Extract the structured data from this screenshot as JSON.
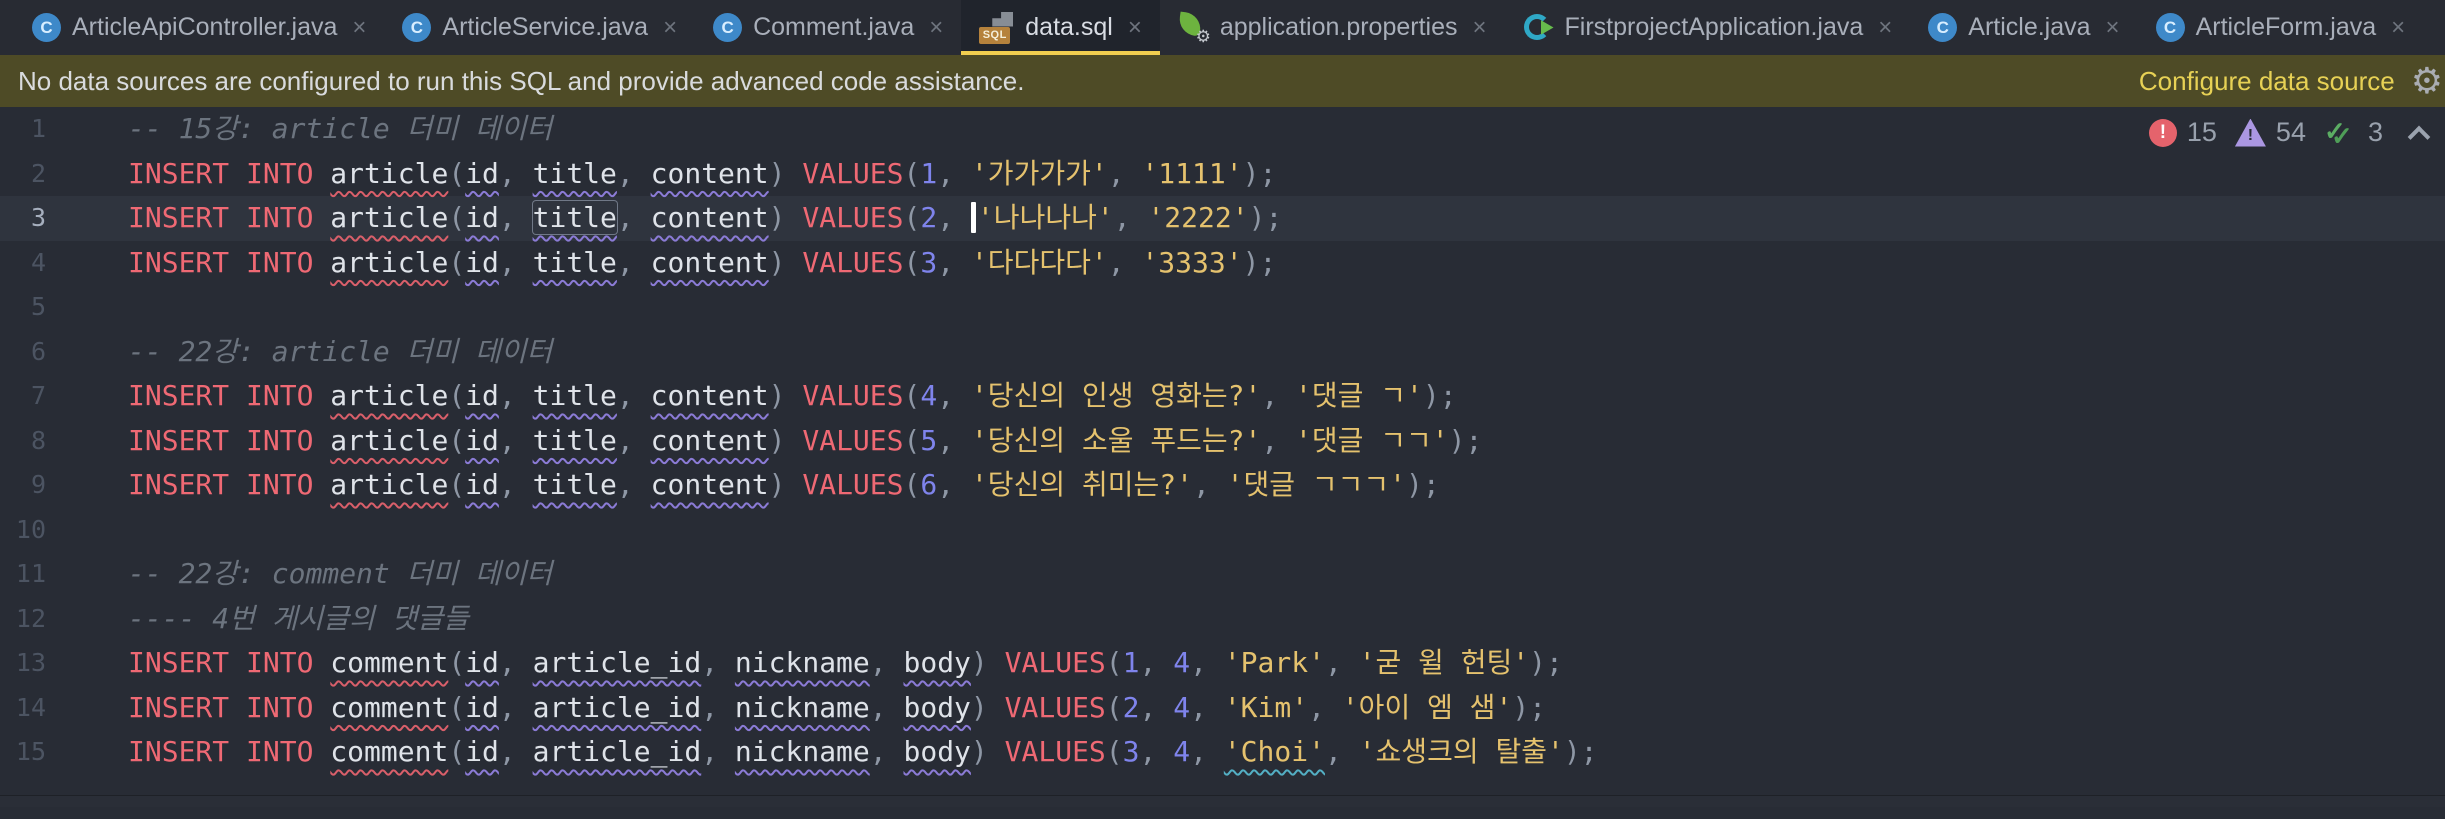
{
  "tabs": [
    {
      "label": "ArticleApiController.java",
      "icon": "java-class-icon",
      "active": false
    },
    {
      "label": "ArticleService.java",
      "icon": "java-class-icon",
      "active": false
    },
    {
      "label": "Comment.java",
      "icon": "java-class-icon",
      "active": false
    },
    {
      "label": "data.sql",
      "icon": "sql-file-icon",
      "active": true
    },
    {
      "label": "application.properties",
      "icon": "spring-properties-icon",
      "active": false
    },
    {
      "label": "FirstprojectApplication.java",
      "icon": "spring-boot-icon",
      "active": false
    },
    {
      "label": "Article.java",
      "icon": "java-class-icon",
      "active": false
    },
    {
      "label": "ArticleForm.java",
      "icon": "java-class-icon",
      "active": false
    }
  ],
  "banner": {
    "message": "No data sources are configured to run this SQL and provide advanced code assistance.",
    "action_label": "Configure data source"
  },
  "inspections": {
    "errors": "15",
    "warnings": "54",
    "ok": "3"
  },
  "icons": {
    "close_glyph": "×",
    "gear_glyph": "⚙",
    "java_class_letter": "C",
    "sql_label": "SQL",
    "exclamation": "!",
    "check": "✓"
  },
  "colors": {
    "editor_background": "#282C35",
    "caret_row": "#2F343E",
    "banner_background": "#4E4B26",
    "active_tab_underline": "#F2CF4F",
    "keyword": "#EF6974",
    "string": "#E5C26E",
    "number": "#7F84EC",
    "comment": "#6C747F",
    "error": "#E5636C",
    "warning": "#AB97E2",
    "success": "#5BAD63"
  },
  "editor": {
    "active_line": 3,
    "lines": [
      {
        "num": "1",
        "segments": [
          {
            "t": "-- 15강: article 더미 데이터",
            "c": "cm"
          }
        ]
      },
      {
        "num": "2",
        "segments": [
          {
            "t": "INSERT INTO",
            "c": "k"
          },
          {
            "t": " ",
            "c": "p"
          },
          {
            "t": "article",
            "c": "tbl"
          },
          {
            "t": "(",
            "c": "p"
          },
          {
            "t": "id",
            "c": "col"
          },
          {
            "t": ", ",
            "c": "p"
          },
          {
            "t": "title",
            "c": "col"
          },
          {
            "t": ", ",
            "c": "p"
          },
          {
            "t": "content",
            "c": "col"
          },
          {
            "t": ") ",
            "c": "p"
          },
          {
            "t": "VALUES",
            "c": "k"
          },
          {
            "t": "(",
            "c": "p"
          },
          {
            "t": "1",
            "c": "n"
          },
          {
            "t": ", ",
            "c": "p"
          },
          {
            "t": "'가가가가'",
            "c": "s"
          },
          {
            "t": ", ",
            "c": "p"
          },
          {
            "t": "'1111'",
            "c": "s"
          },
          {
            "t": ");",
            "c": "p"
          }
        ]
      },
      {
        "num": "3",
        "segments": [
          {
            "t": "INSERT INTO",
            "c": "k"
          },
          {
            "t": " ",
            "c": "p"
          },
          {
            "t": "article",
            "c": "tbl"
          },
          {
            "t": "(",
            "c": "p"
          },
          {
            "t": "id",
            "c": "col"
          },
          {
            "t": ", ",
            "c": "p"
          },
          {
            "t": "title",
            "c": "col box"
          },
          {
            "t": ", ",
            "c": "p"
          },
          {
            "t": "content",
            "c": "col"
          },
          {
            "t": ") ",
            "c": "p"
          },
          {
            "t": "VALUES",
            "c": "k"
          },
          {
            "t": "(",
            "c": "p"
          },
          {
            "t": "2",
            "c": "n"
          },
          {
            "t": ", ",
            "c": "p"
          },
          {
            "t": "",
            "c": "caret"
          },
          {
            "t": "'나나나나'",
            "c": "s"
          },
          {
            "t": ", ",
            "c": "p"
          },
          {
            "t": "'2222'",
            "c": "s"
          },
          {
            "t": ");",
            "c": "p"
          }
        ]
      },
      {
        "num": "4",
        "segments": [
          {
            "t": "INSERT INTO",
            "c": "k"
          },
          {
            "t": " ",
            "c": "p"
          },
          {
            "t": "article",
            "c": "tbl"
          },
          {
            "t": "(",
            "c": "p"
          },
          {
            "t": "id",
            "c": "col"
          },
          {
            "t": ", ",
            "c": "p"
          },
          {
            "t": "title",
            "c": "col"
          },
          {
            "t": ", ",
            "c": "p"
          },
          {
            "t": "content",
            "c": "col"
          },
          {
            "t": ") ",
            "c": "p"
          },
          {
            "t": "VALUES",
            "c": "k"
          },
          {
            "t": "(",
            "c": "p"
          },
          {
            "t": "3",
            "c": "n"
          },
          {
            "t": ", ",
            "c": "p"
          },
          {
            "t": "'다다다다'",
            "c": "s"
          },
          {
            "t": ", ",
            "c": "p"
          },
          {
            "t": "'3333'",
            "c": "s"
          },
          {
            "t": ");",
            "c": "p"
          }
        ]
      },
      {
        "num": "5",
        "segments": []
      },
      {
        "num": "6",
        "segments": [
          {
            "t": "-- 22강: article 더미 데이터",
            "c": "cm"
          }
        ]
      },
      {
        "num": "7",
        "segments": [
          {
            "t": "INSERT INTO",
            "c": "k"
          },
          {
            "t": " ",
            "c": "p"
          },
          {
            "t": "article",
            "c": "tbl"
          },
          {
            "t": "(",
            "c": "p"
          },
          {
            "t": "id",
            "c": "col"
          },
          {
            "t": ", ",
            "c": "p"
          },
          {
            "t": "title",
            "c": "col"
          },
          {
            "t": ", ",
            "c": "p"
          },
          {
            "t": "content",
            "c": "col"
          },
          {
            "t": ") ",
            "c": "p"
          },
          {
            "t": "VALUES",
            "c": "k"
          },
          {
            "t": "(",
            "c": "p"
          },
          {
            "t": "4",
            "c": "n"
          },
          {
            "t": ", ",
            "c": "p"
          },
          {
            "t": "'당신의 인생 영화는?'",
            "c": "s"
          },
          {
            "t": ", ",
            "c": "p"
          },
          {
            "t": "'댓글 ㄱ'",
            "c": "s"
          },
          {
            "t": ");",
            "c": "p"
          }
        ]
      },
      {
        "num": "8",
        "segments": [
          {
            "t": "INSERT INTO",
            "c": "k"
          },
          {
            "t": " ",
            "c": "p"
          },
          {
            "t": "article",
            "c": "tbl"
          },
          {
            "t": "(",
            "c": "p"
          },
          {
            "t": "id",
            "c": "col"
          },
          {
            "t": ", ",
            "c": "p"
          },
          {
            "t": "title",
            "c": "col"
          },
          {
            "t": ", ",
            "c": "p"
          },
          {
            "t": "content",
            "c": "col"
          },
          {
            "t": ") ",
            "c": "p"
          },
          {
            "t": "VALUES",
            "c": "k"
          },
          {
            "t": "(",
            "c": "p"
          },
          {
            "t": "5",
            "c": "n"
          },
          {
            "t": ", ",
            "c": "p"
          },
          {
            "t": "'당신의 소울 푸드는?'",
            "c": "s"
          },
          {
            "t": ", ",
            "c": "p"
          },
          {
            "t": "'댓글 ㄱㄱ'",
            "c": "s"
          },
          {
            "t": ");",
            "c": "p"
          }
        ]
      },
      {
        "num": "9",
        "segments": [
          {
            "t": "INSERT INTO",
            "c": "k"
          },
          {
            "t": " ",
            "c": "p"
          },
          {
            "t": "article",
            "c": "tbl"
          },
          {
            "t": "(",
            "c": "p"
          },
          {
            "t": "id",
            "c": "col"
          },
          {
            "t": ", ",
            "c": "p"
          },
          {
            "t": "title",
            "c": "col"
          },
          {
            "t": ", ",
            "c": "p"
          },
          {
            "t": "content",
            "c": "col"
          },
          {
            "t": ") ",
            "c": "p"
          },
          {
            "t": "VALUES",
            "c": "k"
          },
          {
            "t": "(",
            "c": "p"
          },
          {
            "t": "6",
            "c": "n"
          },
          {
            "t": ", ",
            "c": "p"
          },
          {
            "t": "'당신의 취미는?'",
            "c": "s"
          },
          {
            "t": ", ",
            "c": "p"
          },
          {
            "t": "'댓글 ㄱㄱㄱ'",
            "c": "s"
          },
          {
            "t": ");",
            "c": "p"
          }
        ]
      },
      {
        "num": "10",
        "segments": []
      },
      {
        "num": "11",
        "segments": [
          {
            "t": "-- 22강: comment 더미 데이터",
            "c": "cm"
          }
        ]
      },
      {
        "num": "12",
        "segments": [
          {
            "t": "---- 4번 게시글의 댓글들",
            "c": "cm"
          }
        ]
      },
      {
        "num": "13",
        "segments": [
          {
            "t": "INSERT INTO",
            "c": "k"
          },
          {
            "t": " ",
            "c": "p"
          },
          {
            "t": "comment",
            "c": "tbl"
          },
          {
            "t": "(",
            "c": "p"
          },
          {
            "t": "id",
            "c": "col"
          },
          {
            "t": ", ",
            "c": "p"
          },
          {
            "t": "article_id",
            "c": "col"
          },
          {
            "t": ", ",
            "c": "p"
          },
          {
            "t": "nickname",
            "c": "col"
          },
          {
            "t": ", ",
            "c": "p"
          },
          {
            "t": "body",
            "c": "col"
          },
          {
            "t": ") ",
            "c": "p"
          },
          {
            "t": "VALUES",
            "c": "k"
          },
          {
            "t": "(",
            "c": "p"
          },
          {
            "t": "1",
            "c": "n"
          },
          {
            "t": ", ",
            "c": "p"
          },
          {
            "t": "4",
            "c": "n"
          },
          {
            "t": ", ",
            "c": "p"
          },
          {
            "t": "'Park'",
            "c": "s"
          },
          {
            "t": ", ",
            "c": "p"
          },
          {
            "t": "'굳 윌 헌팅'",
            "c": "s"
          },
          {
            "t": ");",
            "c": "p"
          }
        ]
      },
      {
        "num": "14",
        "segments": [
          {
            "t": "INSERT INTO",
            "c": "k"
          },
          {
            "t": " ",
            "c": "p"
          },
          {
            "t": "comment",
            "c": "tbl"
          },
          {
            "t": "(",
            "c": "p"
          },
          {
            "t": "id",
            "c": "col"
          },
          {
            "t": ", ",
            "c": "p"
          },
          {
            "t": "article_id",
            "c": "col"
          },
          {
            "t": ", ",
            "c": "p"
          },
          {
            "t": "nickname",
            "c": "col"
          },
          {
            "t": ", ",
            "c": "p"
          },
          {
            "t": "body",
            "c": "col"
          },
          {
            "t": ") ",
            "c": "p"
          },
          {
            "t": "VALUES",
            "c": "k"
          },
          {
            "t": "(",
            "c": "p"
          },
          {
            "t": "2",
            "c": "n"
          },
          {
            "t": ", ",
            "c": "p"
          },
          {
            "t": "4",
            "c": "n"
          },
          {
            "t": ", ",
            "c": "p"
          },
          {
            "t": "'Kim'",
            "c": "s"
          },
          {
            "t": ", ",
            "c": "p"
          },
          {
            "t": "'아이 엠 샘'",
            "c": "s"
          },
          {
            "t": ");",
            "c": "p"
          }
        ]
      },
      {
        "num": "15",
        "segments": [
          {
            "t": "INSERT INTO",
            "c": "k"
          },
          {
            "t": " ",
            "c": "p"
          },
          {
            "t": "comment",
            "c": "tbl"
          },
          {
            "t": "(",
            "c": "p"
          },
          {
            "t": "id",
            "c": "col"
          },
          {
            "t": ", ",
            "c": "p"
          },
          {
            "t": "article_id",
            "c": "col"
          },
          {
            "t": ", ",
            "c": "p"
          },
          {
            "t": "nickname",
            "c": "col"
          },
          {
            "t": ", ",
            "c": "p"
          },
          {
            "t": "body",
            "c": "col"
          },
          {
            "t": ") ",
            "c": "p"
          },
          {
            "t": "VALUES",
            "c": "k"
          },
          {
            "t": "(",
            "c": "p"
          },
          {
            "t": "3",
            "c": "n"
          },
          {
            "t": ", ",
            "c": "p"
          },
          {
            "t": "4",
            "c": "n"
          },
          {
            "t": ", ",
            "c": "p"
          },
          {
            "t": "'Choi'",
            "c": "s typo"
          },
          {
            "t": ", ",
            "c": "p"
          },
          {
            "t": "'쇼생크의 탈출'",
            "c": "s"
          },
          {
            "t": ");",
            "c": "p"
          }
        ]
      }
    ]
  }
}
